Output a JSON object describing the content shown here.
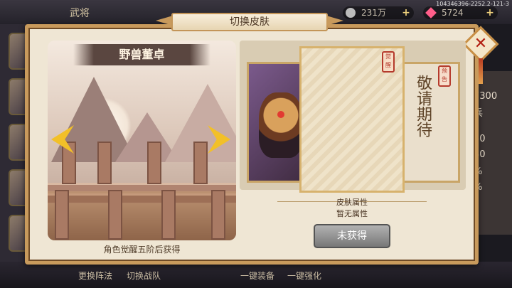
{
  "background": {
    "title": "武将",
    "resources": [
      {
        "icon": "silver-coin-icon",
        "value": "231万"
      },
      {
        "icon": "gem-icon",
        "value": "5724"
      }
    ],
    "build_id": "104346396-2252.2-121-3",
    "right_panel": [
      "7300",
      "兵",
      "50",
      "30",
      "%",
      "%"
    ],
    "bottom_tabs": [
      "更换阵法",
      "切换战队",
      "一键装备",
      "一键强化"
    ]
  },
  "modal": {
    "title": "切换皮肤",
    "close_icon": "close-icon",
    "skin_name": "野兽董卓",
    "unlock_condition": "角色觉醒五阶后获得",
    "seal_left": "觉醒",
    "seal_right": "预告",
    "coming_soon": "敬请期待",
    "attr_title": "皮肤属性",
    "attr_value": "暂无属性",
    "status_button": "未获得",
    "prev_icon": "arrow-left-icon",
    "next_icon": "arrow-right-icon"
  }
}
